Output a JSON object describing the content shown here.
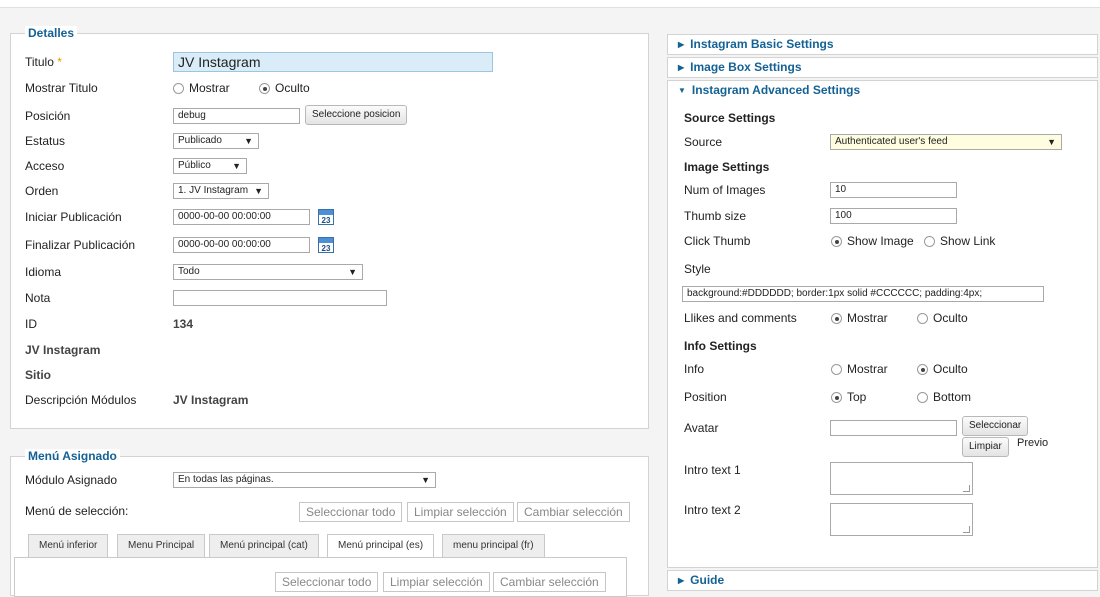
{
  "detalles": {
    "legend": "Detalles",
    "titulo_label": "Titulo",
    "required_mark": "*",
    "titulo_value": "JV Instagram",
    "mostrar_titulo_label": "Mostrar Titulo",
    "mostrar_option": "Mostrar",
    "oculto_option": "Oculto",
    "posicion_label": "Posición",
    "posicion_value": "debug",
    "seleccione_posicion_button": "Seleccione posicion",
    "estatus_label": "Estatus",
    "estatus_value": "Publicado",
    "acceso_label": "Acceso",
    "acceso_value": "Público",
    "orden_label": "Orden",
    "orden_value": "1. JV Instagram",
    "iniciar_label": "Iniciar Publicación",
    "iniciar_value": "0000-00-00 00:00:00",
    "finalizar_label": "Finalizar Publicación",
    "finalizar_value": "0000-00-00 00:00:00",
    "calendar_day": "23",
    "idioma_label": "Idioma",
    "idioma_value": "Todo",
    "nota_label": "Nota",
    "nota_value": "",
    "id_label": "ID",
    "id_value": "134",
    "module_name": "JV Instagram",
    "sitio": "Sitio",
    "descripcion_label": "Descripción Módulos",
    "descripcion_value": "JV Instagram"
  },
  "menu_asignado": {
    "legend": "Menú Asignado",
    "modulo_asignado_label": "Módulo Asignado",
    "modulo_asignado_value": "En todas las páginas.",
    "menu_seleccion_label": "Menú de selección:",
    "seleccionar_todo": "Seleccionar todo",
    "limpiar_seleccion": "Limpiar selección",
    "cambiar_seleccion": "Cambiar selección",
    "tabs": [
      "Menú inferior",
      "Menu Principal",
      "Menú principal (cat)",
      "Menú principal (es)",
      "menu principal (fr)"
    ],
    "active_tab_index": 3
  },
  "right": {
    "basic_settings": "Instagram Basic Settings",
    "image_box_settings": "Image Box Settings",
    "advanced_settings": "Instagram Advanced Settings",
    "guide": "Guide",
    "source_settings": "Source Settings",
    "source_label": "Source",
    "source_value": "Authenticated user's feed",
    "image_settings": "Image Settings",
    "num_images_label": "Num of Images",
    "num_images_value": "10",
    "thumb_size_label": "Thumb size",
    "thumb_size_value": "100",
    "click_thumb_label": "Click Thumb",
    "show_image": "Show Image",
    "show_link": "Show Link",
    "style_label": "Style",
    "style_value": "background:#DDDDDD; border:1px solid #CCCCCC; padding:4px;",
    "likes_label": "Llikes and comments",
    "mostrar": "Mostrar",
    "oculto": "Oculto",
    "info_settings": "Info Settings",
    "info_label": "Info",
    "position_label": "Position",
    "top": "Top",
    "bottom": "Bottom",
    "avatar_label": "Avatar",
    "seleccionar_button": "Seleccionar",
    "limpiar_button": "Limpiar",
    "previo": "Previo",
    "intro1_label": "Intro text 1",
    "intro2_label": "Intro text 2"
  }
}
